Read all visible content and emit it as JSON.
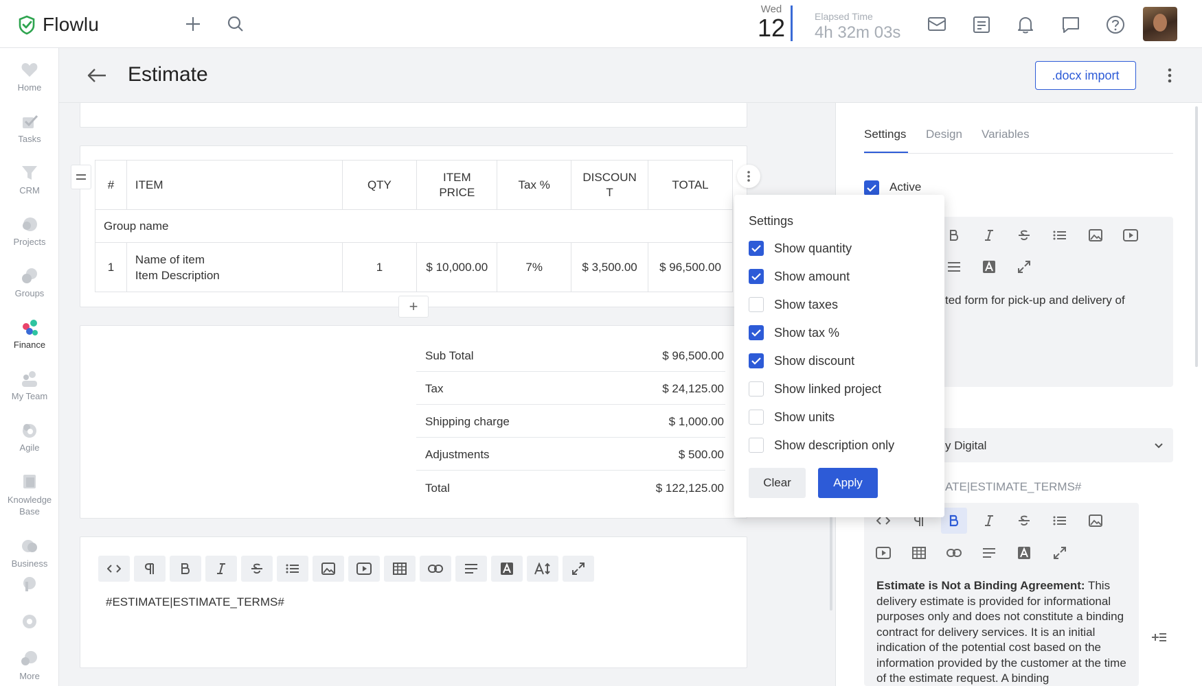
{
  "app": {
    "name": "Flowlu"
  },
  "topbar": {
    "date_day": "Wed",
    "date_num": "12",
    "elapsed_label": "Elapsed Time",
    "elapsed_value": "4h 32m 03s"
  },
  "sidebar": {
    "items": [
      {
        "label": "Home",
        "icon": "heart-icon"
      },
      {
        "label": "Tasks",
        "icon": "check-icon"
      },
      {
        "label": "CRM",
        "icon": "funnel-icon"
      },
      {
        "label": "Projects",
        "icon": "projects-icon"
      },
      {
        "label": "Groups",
        "icon": "groups-icon"
      },
      {
        "label": "Finance",
        "icon": "finance-icon"
      },
      {
        "label": "My Team",
        "icon": "team-icon"
      },
      {
        "label": "Agile",
        "icon": "agile-icon"
      },
      {
        "label": "Knowledge Base",
        "icon": "book-icon"
      },
      {
        "label": "Business",
        "icon": "business-icon"
      },
      {
        "label": "More",
        "icon": "more-icon"
      }
    ]
  },
  "page": {
    "title": "Estimate",
    "docx_import": ".docx import"
  },
  "items_table": {
    "headers": [
      "#",
      "ITEM",
      "QTY",
      "ITEM\nPRICE",
      "Tax %",
      "DISCOUN\nT",
      "TOTAL"
    ],
    "group_name": "Group name",
    "rows": [
      {
        "num": "1",
        "name": "Name of item",
        "description": "Item Description",
        "qty": "1",
        "price": "$ 10,000.00",
        "tax": "7%",
        "discount": "$ 3,500.00",
        "total": "$ 96,500.00"
      }
    ],
    "add_label": "+"
  },
  "totals": [
    {
      "label": "Sub Total",
      "value": "$ 96,500.00"
    },
    {
      "label": "Tax",
      "value": "$ 24,125.00"
    },
    {
      "label": "Shipping charge",
      "value": "$ 1,000.00"
    },
    {
      "label": "Adjustments",
      "value": "$ 500.00"
    },
    {
      "label": "Total",
      "value": "$ 122,125.00"
    }
  ],
  "editor": {
    "content": "#ESTIMATE|ESTIMATE_TERMS#"
  },
  "right_panel": {
    "tabs": [
      "Settings",
      "Design",
      "Variables"
    ],
    "active_label": "Active",
    "partial_text": "ted form for pick-up and delivery of",
    "select_value": "y Digital",
    "terms_var": "ATE|ESTIMATE_TERMS#",
    "terms_bold": "Estimate is Not a Binding Agreement:",
    "terms_text": " This delivery estimate is provided for informational purposes only and does not constitute a binding contract for delivery services. It is an initial indication of the potential cost based on the information provided by the customer at the time of the estimate request. A binding"
  },
  "settings_popup": {
    "title": "Settings",
    "options": [
      {
        "label": "Show quantity",
        "checked": true
      },
      {
        "label": "Show amount",
        "checked": true
      },
      {
        "label": "Show taxes",
        "checked": false
      },
      {
        "label": "Show tax %",
        "checked": true
      },
      {
        "label": "Show discount",
        "checked": true
      },
      {
        "label": "Show linked project",
        "checked": false
      },
      {
        "label": "Show units",
        "checked": false
      },
      {
        "label": "Show description only",
        "checked": false
      }
    ],
    "clear_label": "Clear",
    "apply_label": "Apply"
  },
  "colors": {
    "accent": "#2d5bd7",
    "logo_green": "#2ea44f"
  }
}
